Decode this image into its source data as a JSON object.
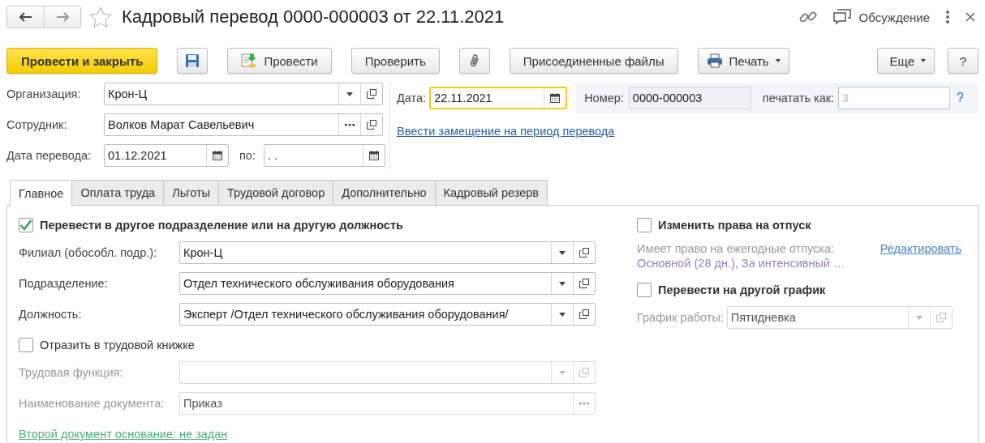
{
  "window": {
    "title": "Кадровый перевод 0000-000003 от 22.11.2021",
    "favorite": false,
    "discussion": "Обсуждение"
  },
  "toolbar": {
    "left": [
      {
        "kind": "primary",
        "label": "Провести и закрыть"
      },
      {
        "kind": "save"
      },
      {
        "kind": "post",
        "label": "Провести"
      },
      {
        "kind": "plain",
        "label": "Проверить"
      },
      {
        "kind": "attach"
      },
      {
        "kind": "plain",
        "label": "Присоединенные файлы"
      },
      {
        "kind": "print",
        "label": "Печать"
      }
    ],
    "right": [
      {
        "kind": "menu",
        "label": "Еще"
      },
      {
        "kind": "plain",
        "label": "?"
      }
    ]
  },
  "header": {
    "organization": {
      "label": "Организация:",
      "value": "Крон-Ц",
      "buttons": [
        {
          "kind": "dropdown"
        },
        {
          "kind": "open"
        }
      ]
    },
    "employee": {
      "label": "Сотрудник:",
      "value": "Волков Марат Савельевич",
      "buttons": [
        {
          "kind": "select"
        },
        {
          "kind": "open"
        }
      ]
    },
    "transfer_date": {
      "label": "Дата перевода:",
      "value": "01.12.2021",
      "buttons": [
        {
          "kind": "calendar"
        }
      ]
    },
    "end_date": {
      "label": "по:",
      "value": ".  .",
      "buttons": [
        {
          "kind": "calendar"
        }
      ]
    },
    "date": {
      "label": "Дата:",
      "value": "22.11.2021",
      "focused": true,
      "buttons": [
        {
          "kind": "calendar"
        }
      ]
    },
    "number": {
      "label": "Номер:",
      "value": "0000-000003",
      "readonly": true
    },
    "print_as": {
      "label": "печатать как:",
      "placeholder": "3"
    },
    "help_link": "?",
    "substitution_link": "Ввести замещение на период перевода"
  },
  "tabs": [
    {
      "label": "Главное",
      "selected": true
    },
    {
      "label": "Оплата труда",
      "selected": false
    },
    {
      "label": "Льготы",
      "selected": false
    },
    {
      "label": "Трудовой договор",
      "selected": false
    },
    {
      "label": "Дополнительно",
      "selected": false
    },
    {
      "label": "Кадровый резерв",
      "selected": false
    }
  ],
  "main_tab": {
    "left": [
      {
        "kind": "checkbox",
        "label": "Перевести в другое подразделение или на другую должность",
        "checked": true,
        "bold": true
      },
      {
        "kind": "field",
        "label": "Филиал (обособл. подр.):",
        "value": "Крон-Ц",
        "buttons": [
          {
            "kind": "dropdown"
          },
          {
            "kind": "open"
          }
        ],
        "disabled": false
      },
      {
        "kind": "field",
        "label": "Подразделение:",
        "value": "Отдел технического обслуживания оборудования",
        "buttons": [
          {
            "kind": "dropdown"
          },
          {
            "kind": "open"
          }
        ],
        "disabled": false
      },
      {
        "kind": "field",
        "label": "Должность:",
        "value": "Эксперт /Отдел технического обслуживания оборудования/",
        "buttons": [
          {
            "kind": "dropdown"
          },
          {
            "kind": "open"
          }
        ],
        "disabled": false
      },
      {
        "kind": "checkbox",
        "label": "Отразить в трудовой книжке",
        "checked": false,
        "bold": false
      },
      {
        "kind": "field",
        "label": "Трудовая функция:",
        "buttons": [
          {
            "kind": "dropdown"
          },
          {
            "kind": "open"
          }
        ],
        "disabled": true
      },
      {
        "kind": "field",
        "label": "Наименование документа:",
        "value": "Приказ",
        "buttons": [
          {
            "kind": "select"
          }
        ],
        "disabled": true
      },
      {
        "kind": "link",
        "label": "Второй документ основание: не задан"
      }
    ],
    "right": [
      {
        "kind": "checkbox",
        "label": "Изменить права на отпуск",
        "checked": false,
        "bold": true
      },
      {
        "kind": "info",
        "label": "Имеет право на ежегодные отпуска:",
        "value": "Основной (28 дн.), За интенсивный …",
        "link": "Редактировать"
      },
      {
        "kind": "checkbox",
        "label": "Перевести на другой график",
        "checked": false,
        "bold": true
      },
      {
        "kind": "field",
        "label": "График работы:",
        "value": "Пятидневка",
        "buttons": [
          {
            "kind": "dropdown"
          },
          {
            "kind": "open"
          }
        ],
        "disabled": true
      }
    ]
  }
}
